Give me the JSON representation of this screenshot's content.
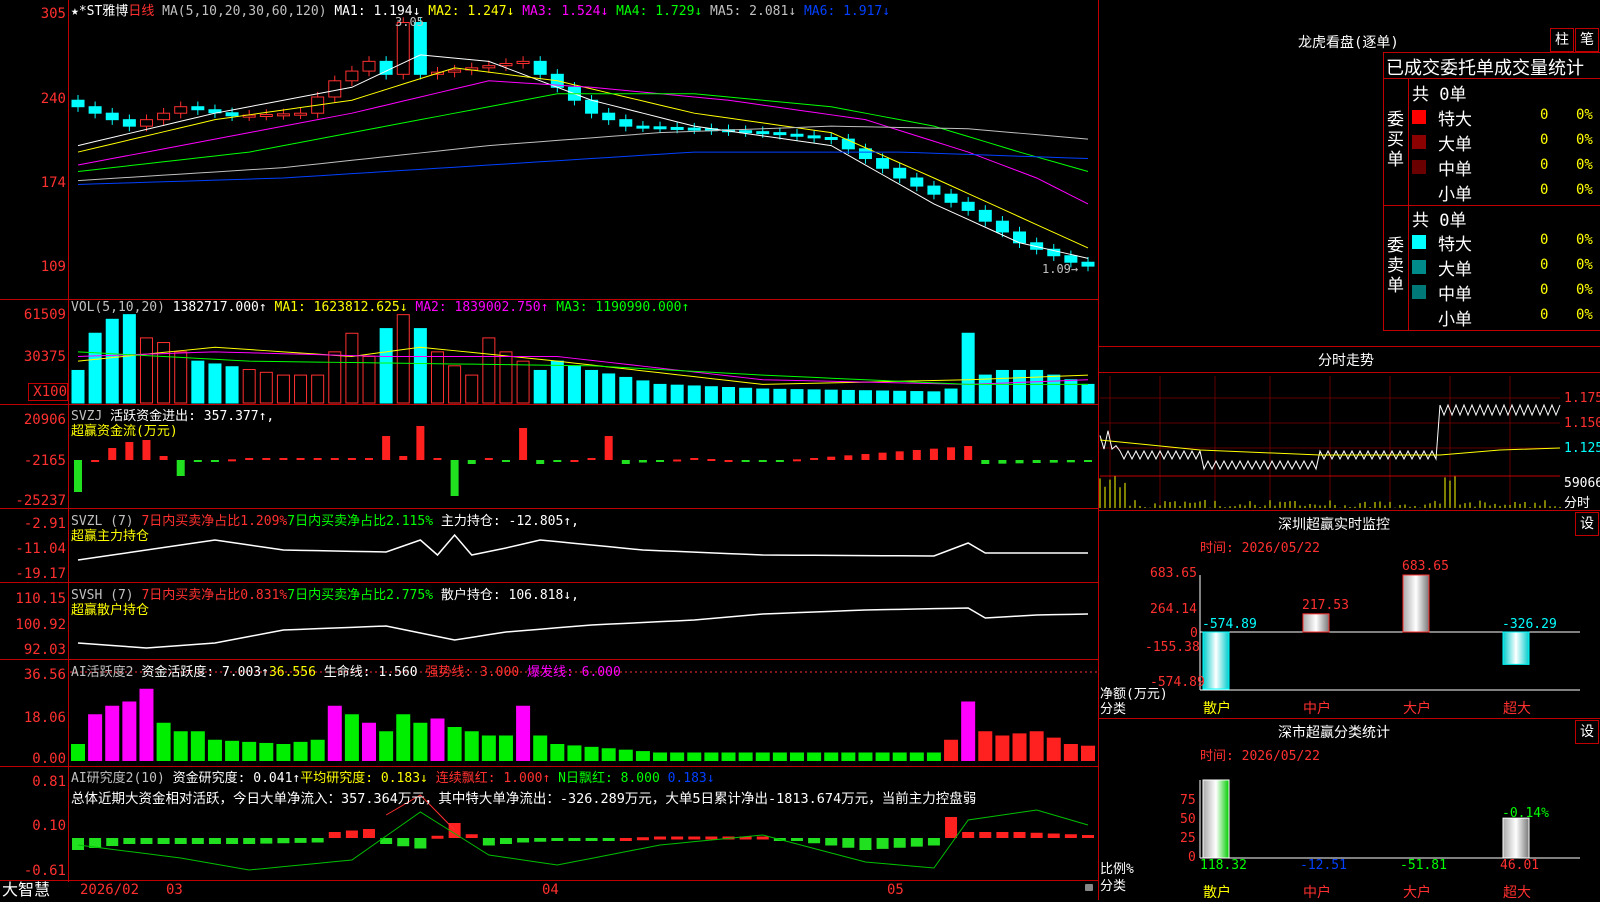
{
  "main_chart": {
    "stock_label": "★*ST雅博",
    "period_label": "日线",
    "ma_prefix": "MA(5,10,20,30,60,120)",
    "ma": [
      {
        "label": "MA1: 1.194↓",
        "color": "#ffffff"
      },
      {
        "label": "MA2: 1.247↓",
        "color": "#ffff00"
      },
      {
        "label": "MA3: 1.524↓",
        "color": "#ff00ff"
      },
      {
        "label": "MA4: 1.729↓",
        "color": "#00ff00"
      },
      {
        "label": "MA5: 2.081↓",
        "color": "#c0c0c0"
      },
      {
        "label": "MA6: 1.917↓",
        "color": "#0040ff"
      }
    ],
    "y_ticks": [
      "305",
      "240",
      "174",
      "109"
    ],
    "high_marker": "3.05",
    "low_marker": "1.09→"
  },
  "volume": {
    "label": "VOL(5,10,20)",
    "value": "1382717.000↑",
    "ma1": "MA1: 1623812.625↓",
    "ma2": "MA2: 1839002.750↑",
    "ma3": "MA3: 1190990.000↑",
    "y_ticks": [
      "61509",
      "30375",
      "X100"
    ]
  },
  "svzj": {
    "label": "SVZJ",
    "title": "活跃资金进出: 357.377↑,",
    "subtitle": "超赢资金流(万元)",
    "y_ticks": [
      "20906",
      "-2165",
      "-25237"
    ]
  },
  "svzl": {
    "label": "SVZL (7)",
    "p1": "7日内买卖净占比1.209%",
    "p2": "7日内买卖净占比2.115%",
    "p3": "主力持仓: -12.805↑,",
    "subtitle": "超赢主力持仓",
    "y_ticks": [
      "-2.91",
      "-11.04",
      "-19.17"
    ]
  },
  "svsh": {
    "label": "SVSH (7)",
    "p1": "7日内买卖净占比0.831%",
    "p2": "7日内买卖净占比2.775%",
    "p3": "散户持仓: 106.818↓,",
    "subtitle": "超赢散户持仓",
    "y_ticks": [
      "110.15",
      "100.92",
      "92.03"
    ]
  },
  "ai_active": {
    "label": "AI活跃度2",
    "p1": "资金活跃度: 7.003↑",
    "p2": "36.556",
    "p3": "生命线: 1.560",
    "p4": "强势线: 3.000",
    "p5": "爆发线: 6.000",
    "y_ticks": [
      "36.56",
      "18.06",
      "0.00"
    ]
  },
  "ai_research": {
    "label": "AI研究度2(10)",
    "p1": "资金研究度: 0.041↑",
    "p2": "平均研究度: 0.183↓",
    "p3": "连续飘红: 1.000↑",
    "p4": "N日飘红: 8.000",
    "p5": "0.183↓",
    "summary": "总体近期大资金相对活跃，今日大单净流入：357.364万元，其中特大单净流出：-326.289万元，大单5日累计净出-1813.674万元，当前主力控盘弱",
    "y_ticks": [
      "0.81",
      "0.10",
      "-0.61"
    ]
  },
  "bottom_bar": {
    "brand": "大智慧",
    "dates": [
      "2026/02",
      "03",
      "04",
      "05"
    ]
  },
  "dragon_tiger": {
    "title": "龙虎看盘(逐单)",
    "btn1": "柱",
    "btn2": "笔",
    "tab_header": "已成交委托单成交量统计",
    "buy_side_label": "委买单",
    "sell_side_label": "委卖单",
    "buy_total": "共 0单",
    "sell_total": "共 0单",
    "buy_rows": [
      {
        "name": "特大",
        "count": "0",
        "pct": "0%",
        "color": "#ff0000"
      },
      {
        "name": "大单",
        "count": "0",
        "pct": "0%",
        "color": "#8b0000"
      },
      {
        "name": "中单",
        "count": "0",
        "pct": "0%",
        "color": "#6b0000"
      },
      {
        "name": "小单",
        "count": "0",
        "pct": "0%",
        "color": "#000000"
      }
    ],
    "sell_rows": [
      {
        "name": "特大",
        "count": "0",
        "pct": "0%",
        "color": "#00ffff"
      },
      {
        "name": "大单",
        "count": "0",
        "pct": "0%",
        "color": "#008b8b"
      },
      {
        "name": "中单",
        "count": "0",
        "pct": "0%",
        "color": "#007878"
      },
      {
        "name": "小单",
        "count": "0",
        "pct": "0%",
        "color": "#000000"
      }
    ]
  },
  "intraday": {
    "title": "分时走势",
    "prices": [
      "1.175",
      "1.150",
      "1.125"
    ],
    "volume": "59066",
    "bottom_label": "分时"
  },
  "sz_monitor": {
    "title": "深圳超赢实时监控",
    "settings": "设",
    "time": "时间: 2026/05/22",
    "y_ticks": [
      "683.65",
      "264.14",
      "0",
      "-155.38",
      "-574.89"
    ],
    "axis_label": "净额(万元)",
    "axis_label2": "分类",
    "categories": [
      "散户",
      "中户",
      "大户",
      "超大"
    ],
    "values": [
      "-574.89",
      "217.53",
      "683.65",
      "-326.29"
    ]
  },
  "sz_classify": {
    "title": "深市超赢分类统计",
    "settings": "设",
    "time": "时间: 2026/05/22",
    "y_ticks": [
      "75",
      "50",
      "25",
      "0"
    ],
    "axis_label": "比例%",
    "axis_label2": "分类",
    "categories": [
      "散户",
      "中户",
      "大户",
      "超大"
    ],
    "values": [
      "118.32",
      "-12.51",
      "-51.81",
      "46.01"
    ],
    "top_label": "-0.14%"
  },
  "chart_data": [
    {
      "type": "bar",
      "title": "深圳超赢实时监控",
      "ylabel": "净额(万元)",
      "categories": [
        "散户",
        "中户",
        "大户",
        "超大"
      ],
      "values": [
        -574.89,
        217.53,
        683.65,
        -326.29
      ],
      "ylim": [
        -574.89,
        683.65
      ]
    },
    {
      "type": "bar",
      "title": "深市超赢分类统计",
      "ylabel": "比例%",
      "categories": [
        "散户",
        "中户",
        "大户",
        "超大"
      ],
      "values": [
        118.32,
        -12.51,
        -51.81,
        46.01
      ],
      "ylim": [
        0,
        75
      ]
    }
  ]
}
